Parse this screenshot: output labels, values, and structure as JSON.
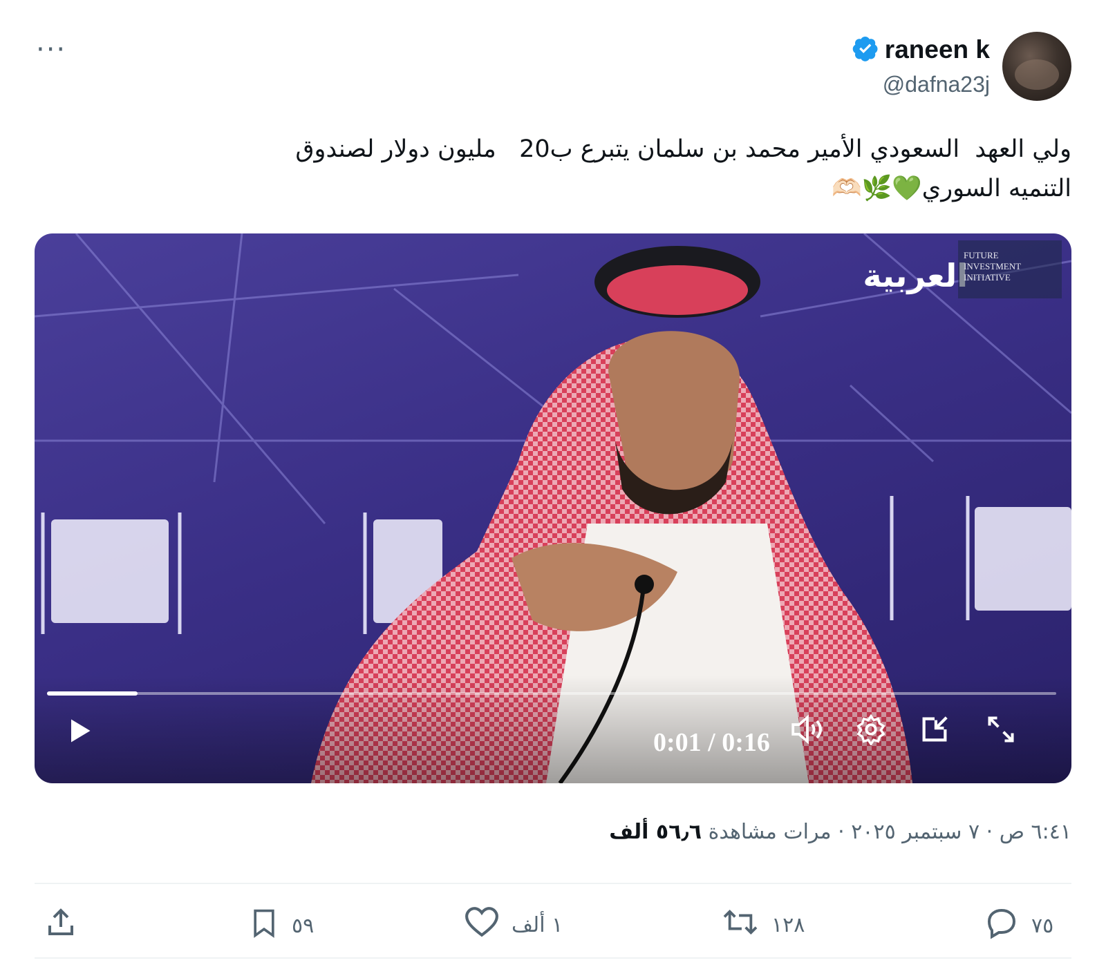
{
  "header": {
    "more_label": "···",
    "name": "raneen k",
    "handle": "@dafna23j"
  },
  "tweet": {
    "text_line1": "ولي العهد  السعودي الأمير محمد بن سلمان يتبرع ب20   مليون دولار لصندوق",
    "text_line2": "التنميه السوري💚🌿🫶🏻"
  },
  "video": {
    "watermark_logo": "العربية",
    "event_badge": "FUTURE INVESTMENT INITIATIVE",
    "progress": 0.09,
    "time_display": "0:01 / 0:16"
  },
  "meta": {
    "time": "٦:٤١ ص",
    "date": "٧ سبتمبر ٢٠٢٥",
    "views_count": "٥٦٫٦ ألف",
    "views_label": "مرات مشاهدة",
    "separator": "·"
  },
  "actions": {
    "replies": "٧٥",
    "reposts": "١٢٨",
    "likes": "١ ألف",
    "bookmarks": "٥٩"
  },
  "colors": {
    "verified": "#1d9bf0",
    "secondary_text": "#536471",
    "primary_text": "#0f1419"
  }
}
